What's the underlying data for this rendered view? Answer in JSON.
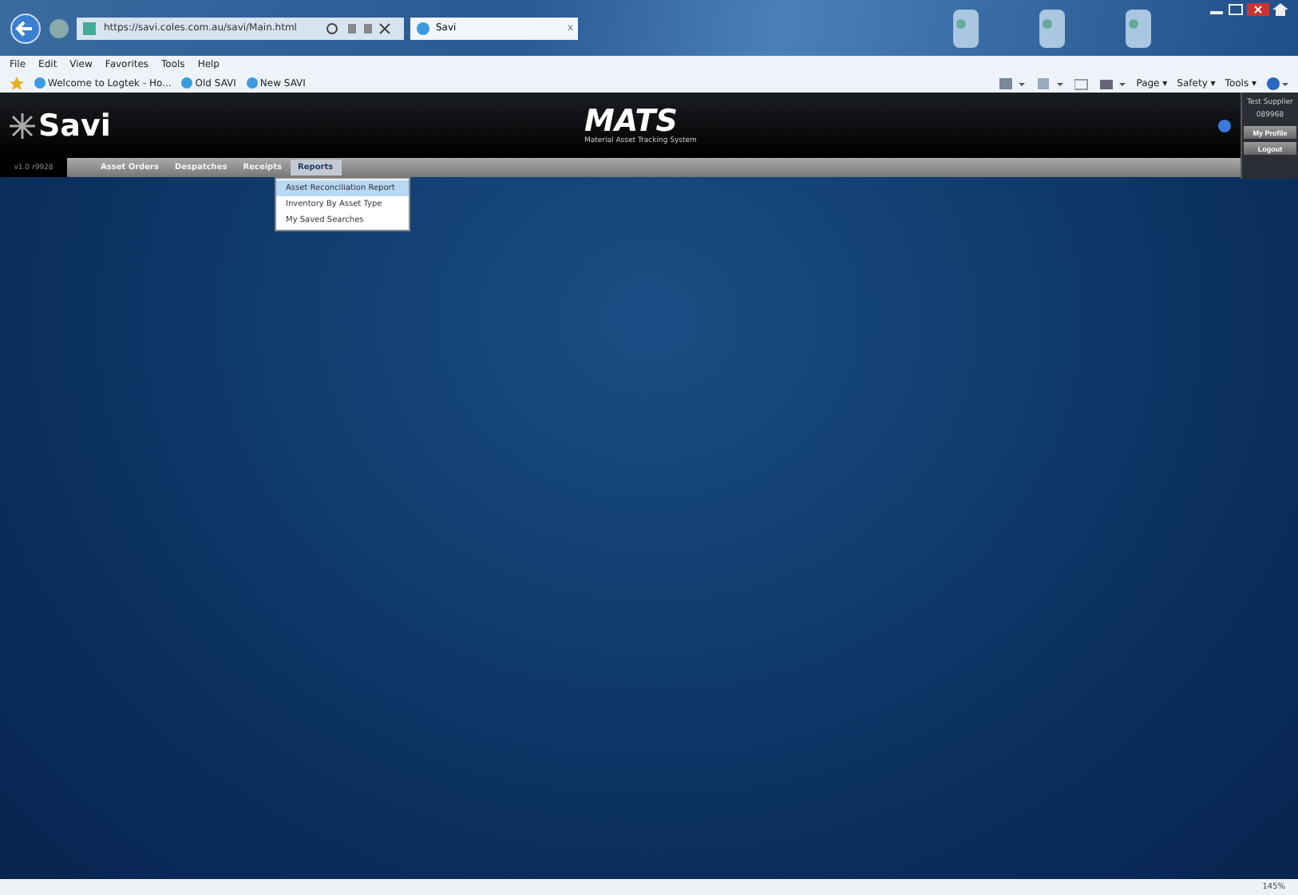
{
  "browser": {
    "address": "https://savi.coles.com.au/savi/Main.html",
    "tab": {
      "title": "Savi",
      "close": "x"
    },
    "menu": [
      "File",
      "Edit",
      "View",
      "Favorites",
      "Tools",
      "Help"
    ],
    "favorites": [
      "Welcome to Logtek - Ho...",
      "Old SAVI",
      "New SAVI"
    ],
    "commands": [
      "Page ▾",
      "Safety ▾",
      "Tools ▾"
    ],
    "zoom": "145%"
  },
  "app": {
    "logo": "Savi",
    "title": "MATS",
    "subtitle": "Material Asset Tracking System",
    "version": "v1.0 r9928",
    "user": {
      "name": "Test Supplier",
      "id": "089968"
    },
    "buttons": [
      "My Profile",
      "Logout"
    ],
    "nav": [
      {
        "label": "Asset Orders",
        "selected": false
      },
      {
        "label": "Despatches",
        "selected": false
      },
      {
        "label": "Receipts",
        "selected": false
      },
      {
        "label": "Reports",
        "selected": true
      }
    ],
    "dropdown": [
      {
        "label": "Asset Reconciliation Report",
        "selected": true
      },
      {
        "label": "Inventory By Asset Type",
        "selected": false
      },
      {
        "label": "My Saved Searches",
        "selected": false
      }
    ]
  }
}
